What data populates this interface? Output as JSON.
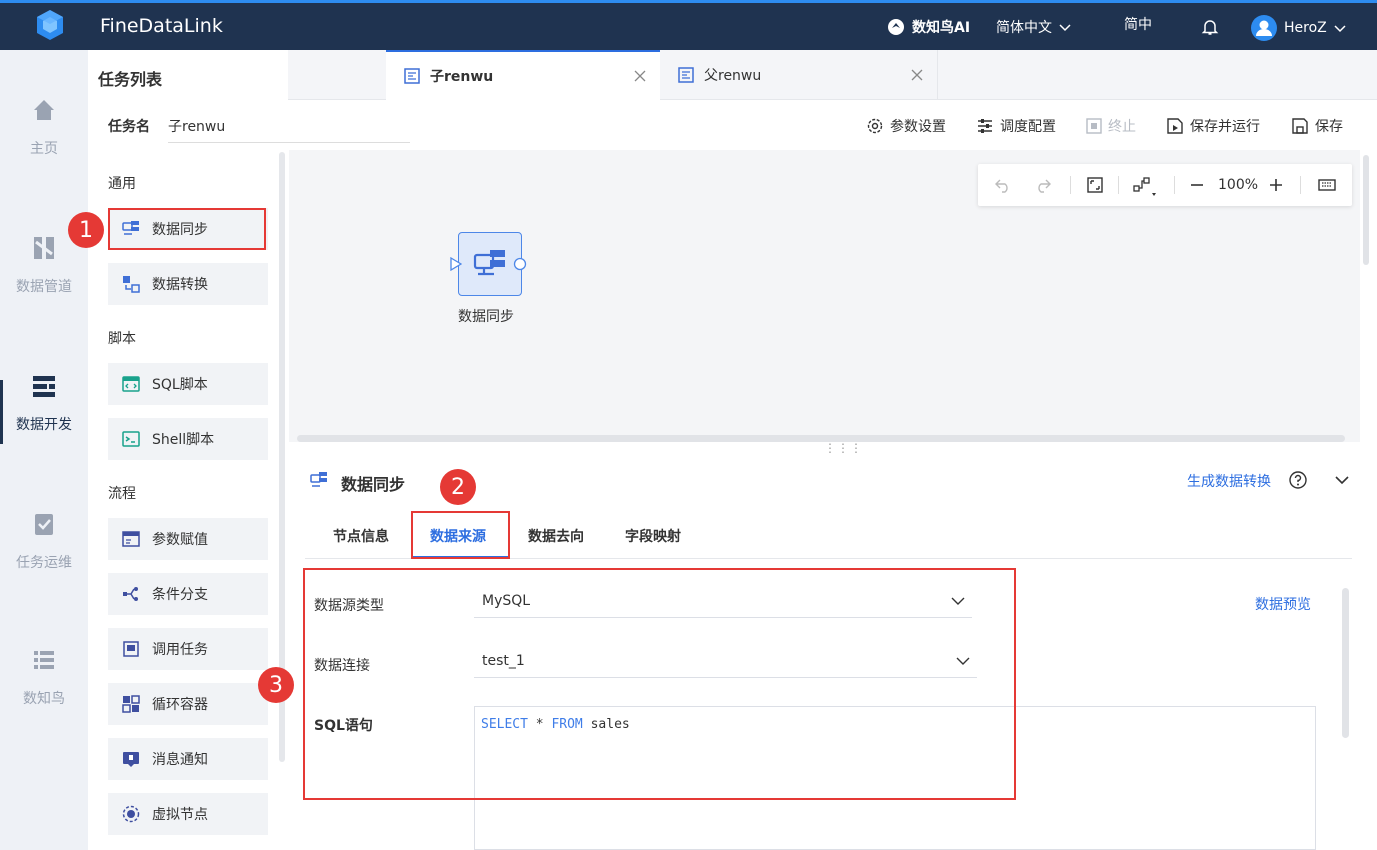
{
  "app": {
    "brand": "FineDataLink",
    "ai_label": "数知鸟AI",
    "language": "简体中文",
    "lang_short": "简中",
    "user": "HeroZ"
  },
  "nav": {
    "items": [
      {
        "label": "主页",
        "icon": "home-icon"
      },
      {
        "label": "数据管道",
        "icon": "pipeline-icon"
      },
      {
        "label": "数据开发",
        "icon": "data-dev-icon",
        "active": true
      },
      {
        "label": "任务运维",
        "icon": "task-ops-icon"
      },
      {
        "label": "数知鸟",
        "icon": "list-icon"
      }
    ]
  },
  "panel": {
    "title": "任务列表",
    "task_name_label": "任务名",
    "task_name_value": "子renwu",
    "sections": [
      {
        "title": "通用",
        "items": [
          "数据同步",
          "数据转换"
        ]
      },
      {
        "title": "脚本",
        "items": [
          "SQL脚本",
          "Shell脚本"
        ]
      },
      {
        "title": "流程",
        "items": [
          "参数赋值",
          "条件分支",
          "调用任务",
          "循环容器",
          "消息通知",
          "虚拟节点"
        ]
      }
    ]
  },
  "tabs": [
    {
      "label": "子renwu",
      "active": true
    },
    {
      "label": "父renwu",
      "active": false
    }
  ],
  "toolbar": {
    "params": "参数设置",
    "schedule": "调度配置",
    "stop": "终止",
    "save_run": "保存并运行",
    "save": "保存"
  },
  "canvas": {
    "zoom": "100%",
    "node_label": "数据同步"
  },
  "detail": {
    "title": "数据同步",
    "generate_link": "生成数据转换",
    "tabs": [
      "节点信息",
      "数据来源",
      "数据去向",
      "字段映射"
    ],
    "active_tab": "数据来源",
    "source_type_label": "数据源类型",
    "source_type_value": "MySQL",
    "connection_label": "数据连接",
    "connection_value": "test_1",
    "sql_label": "SQL语句",
    "sql_kw1": "SELECT",
    "sql_mid": " * ",
    "sql_kw2": "FROM",
    "sql_rest": " sales",
    "preview_link": "数据预览"
  },
  "annotations": {
    "badge1": "1",
    "badge2": "2",
    "badge3": "3"
  },
  "colors": {
    "topbar": "#1f3350",
    "accent": "#2d6ee0",
    "annotation": "#e53935"
  }
}
